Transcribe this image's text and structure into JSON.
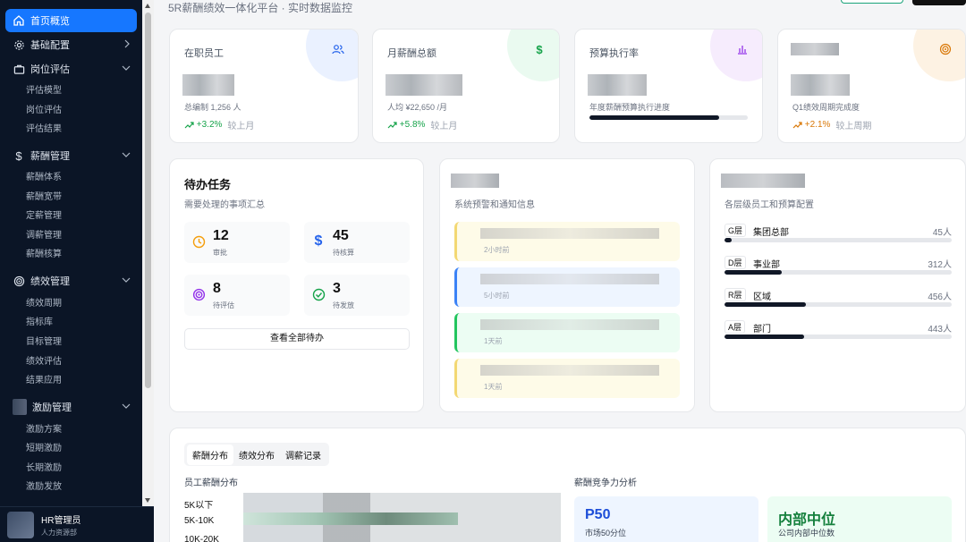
{
  "sidebar": {
    "active": {
      "label": "首页概览"
    },
    "groups": [
      {
        "label": "基础配置",
        "icon": "gear-icon"
      },
      {
        "label": "岗位评估",
        "icon": "briefcase-icon",
        "items": [
          "评估模型",
          "岗位评估",
          "评估结果"
        ]
      },
      {
        "label": "薪酬管理",
        "icon": "dollar-icon",
        "items": [
          "薪酬体系",
          "薪酬宽带",
          "定薪管理",
          "调薪管理",
          "薪酬核算"
        ]
      },
      {
        "label": "绩效管理",
        "icon": "target-icon",
        "items": [
          "绩效周期",
          "指标库",
          "目标管理",
          "绩效评估",
          "结果应用"
        ]
      },
      {
        "label": "激励管理",
        "icon": "gift-icon",
        "items": [
          "激励方案",
          "短期激励",
          "长期激励",
          "激励发放"
        ]
      }
    ],
    "user": {
      "name": "HR管理员",
      "role": "人力资源部"
    }
  },
  "header": {
    "subtitle": "5R薪酬绩效一体化平台 · 实时数据监控"
  },
  "stats": [
    {
      "label": "在职员工",
      "note": "总编制 1,256 人",
      "change": "+3.2%",
      "compare": "较上月",
      "icon": "users-icon",
      "color": "#2563eb"
    },
    {
      "label": "月薪酬总额",
      "note": "人均 ¥22,650 /月",
      "change": "+5.8%",
      "compare": "较上月",
      "icon": "dollar-icon",
      "color": "#16a34a"
    },
    {
      "label": "预算执行率",
      "note": "年度薪酬预算执行进度",
      "progress": 0.82,
      "icon": "chart-icon",
      "color": "#9333ea"
    },
    {
      "label": "",
      "note": "Q1绩效周期完成度",
      "change": "+2.1%",
      "compare": "较上周期",
      "icon": "target-icon",
      "color": "#d97706"
    }
  ],
  "todo": {
    "title": "待办任务",
    "subtitle": "需要处理的事项汇总",
    "items": [
      {
        "count": "12",
        "label": "审批",
        "icon": "clock-icon",
        "color": "#f59e0b"
      },
      {
        "count": "45",
        "label": "待核算",
        "icon": "dollar-icon",
        "color": "#2563eb"
      },
      {
        "count": "8",
        "label": "待评估",
        "icon": "target-icon",
        "color": "#9333ea"
      },
      {
        "count": "3",
        "label": "待发放",
        "icon": "check-circle-icon",
        "color": "#16a34a"
      }
    ],
    "button": "查看全部待办"
  },
  "notices": {
    "subtitle": "系统预警和通知信息",
    "items": [
      {
        "time": "2小时前",
        "bg": "#fefbe8",
        "border": "#f3d873"
      },
      {
        "time": "5小时前",
        "bg": "#eef5ff",
        "border": "#3b82f6"
      },
      {
        "time": "1天前",
        "bg": "#ecfdf3",
        "border": "#22c55e"
      },
      {
        "time": "1天前",
        "bg": "#fefbe8",
        "border": "#f3d873"
      }
    ]
  },
  "levels": {
    "subtitle": "各层级员工和预算配置",
    "items": [
      {
        "tag": "G层",
        "name": "集团总部",
        "count": "45人",
        "progress": 0.03
      },
      {
        "tag": "D层",
        "name": "事业部",
        "count": "312人",
        "progress": 0.25
      },
      {
        "tag": "R层",
        "name": "区域",
        "count": "456人",
        "progress": 0.36
      },
      {
        "tag": "A层",
        "name": "部门",
        "count": "443人",
        "progress": 0.35
      }
    ]
  },
  "bottom": {
    "tabs": [
      "薪酬分布",
      "绩效分布",
      "调薪记录"
    ],
    "dist_title": "员工薪酬分布",
    "dist_rows": [
      "5K以下",
      "5K-10K",
      "10K-20K"
    ],
    "comp_title": "薪酬竞争力分析",
    "comp": [
      {
        "big": "P50",
        "small": "市场50分位",
        "color": "#1d4ed8",
        "bg": "#eef5ff"
      },
      {
        "big": "内部中位",
        "small": "公司内部中位数",
        "color": "#15803d",
        "bg": "#ecfdf3"
      }
    ]
  }
}
